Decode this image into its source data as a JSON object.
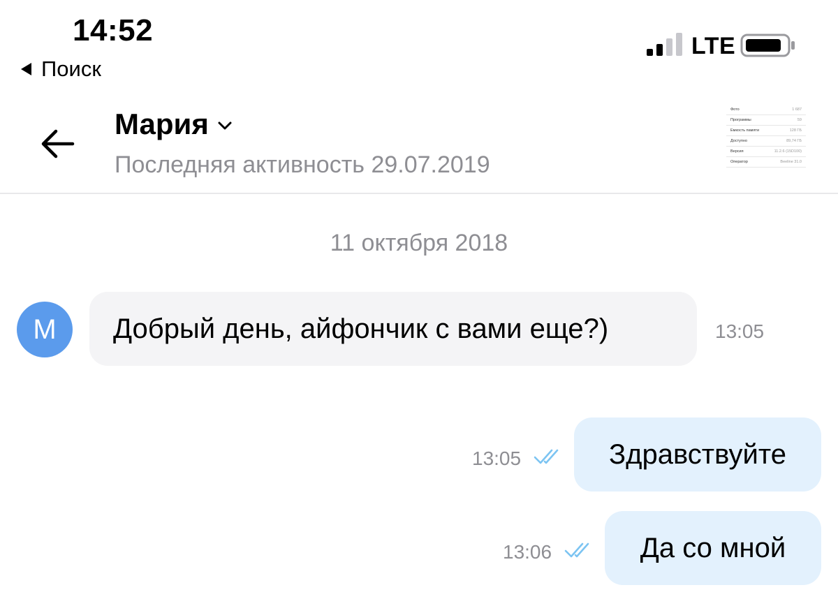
{
  "status_bar": {
    "time": "14:52",
    "back_label": "Поиск",
    "network": "LTE",
    "signal_bars_active": 2,
    "signal_bars_total": 4,
    "battery_icon": "battery-icon"
  },
  "header": {
    "contact_name": "Мария",
    "last_seen": "Последняя активность 29.07.2019",
    "attachment_rows": [
      {
        "label": "Фото",
        "value": "1 687"
      },
      {
        "label": "Программы",
        "value": "59"
      },
      {
        "label": "Емкость памяти",
        "value": "128 ГБ"
      },
      {
        "label": "Доступно",
        "value": "89,74 ГБ"
      },
      {
        "label": "Версия",
        "value": "11.2.6 (15D100)"
      },
      {
        "label": "Оператор",
        "value": "Beeline 31.0"
      }
    ]
  },
  "conversation": {
    "date_separator": "11 октября 2018",
    "avatar_letter": "М",
    "messages": [
      {
        "direction": "in",
        "text": "Добрый день, айфончик с вами еще?)",
        "time": "13:05"
      },
      {
        "direction": "out",
        "text": "Здравствуйте",
        "time": "13:05",
        "status_icon": "double-check-icon"
      },
      {
        "direction": "out",
        "text": "Да со мной",
        "time": "13:06",
        "status_icon": "double-check-icon"
      }
    ]
  },
  "colors": {
    "avatar_bg": "#5b9bec",
    "incoming_bubble": "#f4f4f6",
    "outgoing_bubble": "#e3f1fd",
    "muted_text": "#8e8e93",
    "read_check": "#7cc4f2"
  }
}
